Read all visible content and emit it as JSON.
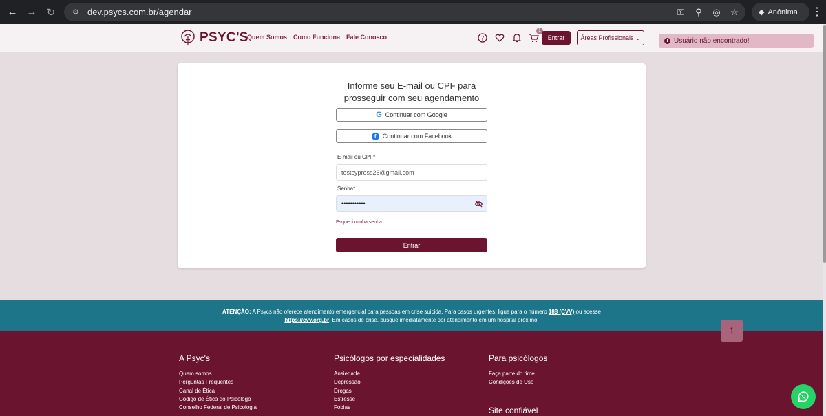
{
  "browser": {
    "url": "dev.psycs.com.br/agendar",
    "profile_label": "Anônima"
  },
  "header": {
    "logo_text": "PSYC'S",
    "nav": [
      {
        "label": "Quem Somos"
      },
      {
        "label": "Como Funciona"
      },
      {
        "label": "Fale Conosco"
      }
    ],
    "cart_count": "1",
    "login_label": "Entrar",
    "areas_label": "Áreas Profissionais"
  },
  "toast": {
    "message": "Usuário não encontrado!",
    "color": "#e0b8c6"
  },
  "login": {
    "title_line1": "Informe seu E-mail ou CPF para",
    "title_line2": "prosseguir com seu agendamento",
    "google_label": "Continuar com Google",
    "facebook_label": "Continuar com Facebook",
    "email_label": "E-mail ou CPF*",
    "email_value": "testcypress26@gmail.com",
    "password_label": "Senha*",
    "password_value": "•••••••••••",
    "forgot_label": "Esqueci minha senha",
    "submit_label": "Entrar"
  },
  "alert": {
    "prefix": "ATENÇÃO:",
    "text1": " A Psycs não oferece atendimento emergencial para pessoas em crise suicida. Para casos urgentes, ligue para o número ",
    "cvv_link": "188 (CVV)",
    "text2": " ou acesse",
    "site_link": "https://cvv.org.br",
    "text3": ". Em casos de crise, busque imediatamente por atendimento em um hospital próximo."
  },
  "footer": {
    "col1": {
      "title": "A Psyc's",
      "links": [
        "Quem somos",
        "Perguntas Frequentes",
        "Canal de Ética",
        "Código de Ética do Psicólogo",
        "Conselho Federal de Psicologia"
      ]
    },
    "col2": {
      "title": "Psicólogos por especialidades",
      "links": [
        "Ansiedade",
        "Depressão",
        "Drogas",
        "Estresse",
        "Fobias"
      ]
    },
    "col3": {
      "title": "Para psicólogos",
      "links": [
        "Faça parte do time",
        "Condições de Uso"
      ]
    },
    "site_confiavel": "Site confiável"
  },
  "colors": {
    "brand": "#6b1430",
    "alert_bg": "#1d7589",
    "whatsapp": "#25d366"
  }
}
